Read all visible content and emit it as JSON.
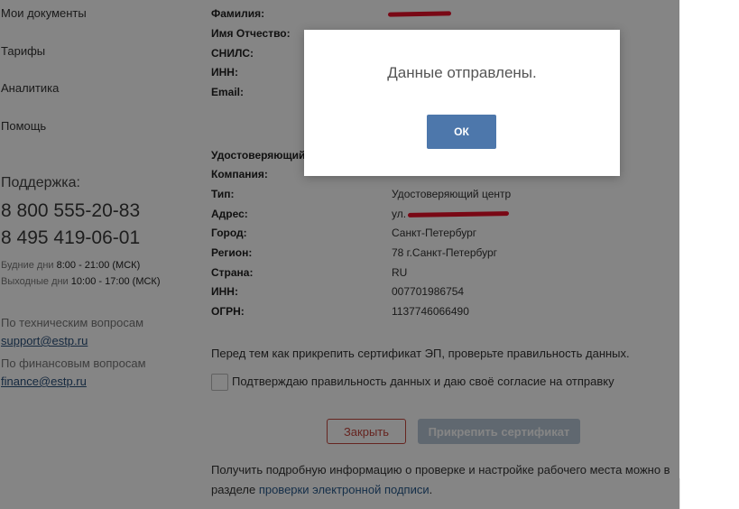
{
  "sidebar": {
    "nav": [
      "Мои документы",
      "Тарифы",
      "Аналитика",
      "Помощь"
    ],
    "support_title": "Поддержка:",
    "phones": [
      "8 800 555-20-83",
      "8 495 419-06-01"
    ],
    "hours": [
      {
        "label": "Будние дни",
        "time": "8:00 - 21:00 (МСК)"
      },
      {
        "label": "Выходные дни",
        "time": "10:00 - 17:00 (МСК)"
      }
    ],
    "tech_hint": "По техническим вопросам",
    "tech_email": "support@estp.ru",
    "fin_hint": "По финансовым вопросам",
    "fin_email": "finance@estp.ru"
  },
  "person": {
    "rows": [
      {
        "label": "Фамилия:",
        "value": ""
      },
      {
        "label": "Имя Отчество:",
        "value": ""
      },
      {
        "label": "СНИЛС:",
        "value": ""
      },
      {
        "label": "ИНН:",
        "value": ""
      },
      {
        "label": "Email:",
        "value": ""
      }
    ]
  },
  "ca": {
    "rows": [
      {
        "label": "Удостоверяющий центр:",
        "value": ""
      },
      {
        "label": "Компания:",
        "value": ""
      },
      {
        "label": "Тип:",
        "value": "Удостоверяющий центр"
      },
      {
        "label": "Адрес:",
        "value": "ул."
      },
      {
        "label": "Город:",
        "value": "Санкт-Петербург"
      },
      {
        "label": "Регион:",
        "value": "78 г.Санкт-Петербург"
      },
      {
        "label": "Страна:",
        "value": "RU"
      },
      {
        "label": "ИНН:",
        "value": "007701986754"
      },
      {
        "label": "ОГРН:",
        "value": "1137746066490"
      }
    ]
  },
  "warning": "Перед тем как прикрепить сертификат ЭП, проверьте правильность данных.",
  "consent": "Подтверждаю правильность данных и даю своё согласие на отправку",
  "buttons": {
    "close": "Закрыть",
    "attach": "Прикрепить сертификат"
  },
  "info": {
    "text": "Получить подробную информацию о проверке и настройке рабочего места можно в разделе ",
    "link": "проверки электронной подписи",
    "tail": "."
  },
  "modal": {
    "message": "Данные отправлены.",
    "ok": "ОК"
  }
}
